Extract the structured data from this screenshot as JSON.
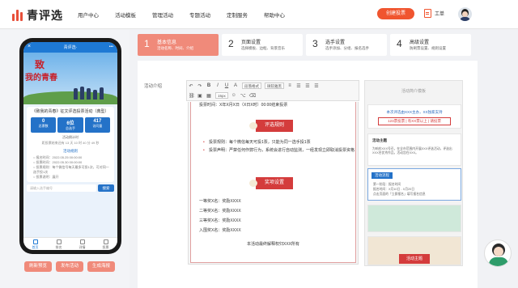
{
  "brand": {
    "name": "青评选",
    "accent": "#f0552f"
  },
  "nav": [
    "用户中心",
    "活动模板",
    "管理活动",
    "专题活动",
    "定制服务",
    "帮助中心"
  ],
  "header": {
    "create_label": "创建投票",
    "ticket_label": "工单",
    "ticket_icon": "ticket-icon"
  },
  "steps": [
    {
      "num": "1",
      "title": "基本信息",
      "sub": "活动名称、时间、介绍"
    },
    {
      "num": "2",
      "title": "页面设置",
      "sub": "选择模板、边框、背景音乐"
    },
    {
      "num": "3",
      "title": "选手设置",
      "sub": "选手添加、分组、报名选手"
    },
    {
      "num": "4",
      "title": "高级设置",
      "sub": "防刷票设置、规则设置"
    }
  ],
  "phone": {
    "topbar_title": "青评选·",
    "hero_line1": "致",
    "hero_line2": "我的青春",
    "card_title": "《致我的青春》征文评选投票活动（典型）",
    "stats": [
      {
        "value": "0",
        "label": "总票数"
      },
      {
        "value": "6位",
        "label": "总选手"
      },
      {
        "value": "417",
        "label": "访问量"
      }
    ],
    "countdown_label": "活动倒计时",
    "countdown_value": "距投票结束还有 13 天 10 时 40 分 49 秒",
    "rules_heading": "活动规则",
    "rules": [
      "○ 报名时间：2022.05.25 00:00:00",
      "○ 投票时间：2022.05.30 00:00:00",
      "○ 投票规则：每个微信号每天最多可投1次，可对同一选手投1次",
      "○ 投票说明：展开"
    ],
    "search_placeholder": "请输入选手编号",
    "search_button": "搜索",
    "tabs": [
      "首页",
      "排名",
      "详情",
      "投票"
    ]
  },
  "phone_buttons": [
    "刷新预览",
    "发布活动",
    "生成海报"
  ],
  "editor": {
    "field_label": "活动介绍",
    "font_family": "微软雅黑",
    "font_size": "15px",
    "format": "段落格式",
    "cut_line": "投票时间：X年X月X日（X日X时）00:00结束投票",
    "rules_button": "评选规则",
    "rule1": "投票规则：每个微信每天可投1票，只能为同一选手投1票",
    "rule2": "投票声明：严禁任何作弊行为，系统会进行自动监测，一经发现立即取消投票资格",
    "awards_button": "奖项设置",
    "prizes": [
      "一等奖X名：奖励XXXX",
      "二等奖X名：奖励XXXX",
      "三等奖X名：奖励XXXX",
      "入围奖X名：奖励XXXX"
    ],
    "footer": "本活动最终解释权归XXX所有"
  },
  "templates": {
    "heading": "活动简介模板",
    "t1_a": "本次评选由XXX主办，XX独家支持",
    "t1_b": "123票投票 | 有XX票以上 | 请投票",
    "t2_title": "活动主题",
    "t2_text": "为响应XXX号召，在全市范围内开展XXX评选活动，评选出XXX名优秀作品，活动旨在XXX。",
    "t3_title": "活动流程",
    "t3_lines": [
      "第一阶段：报名时间",
      "报名时间：X月10日 - X月20日",
      "点击页面的「立即报名」填写报名信息"
    ],
    "t5_button": "活动主题"
  },
  "support_icon": "customer-service-avatar"
}
